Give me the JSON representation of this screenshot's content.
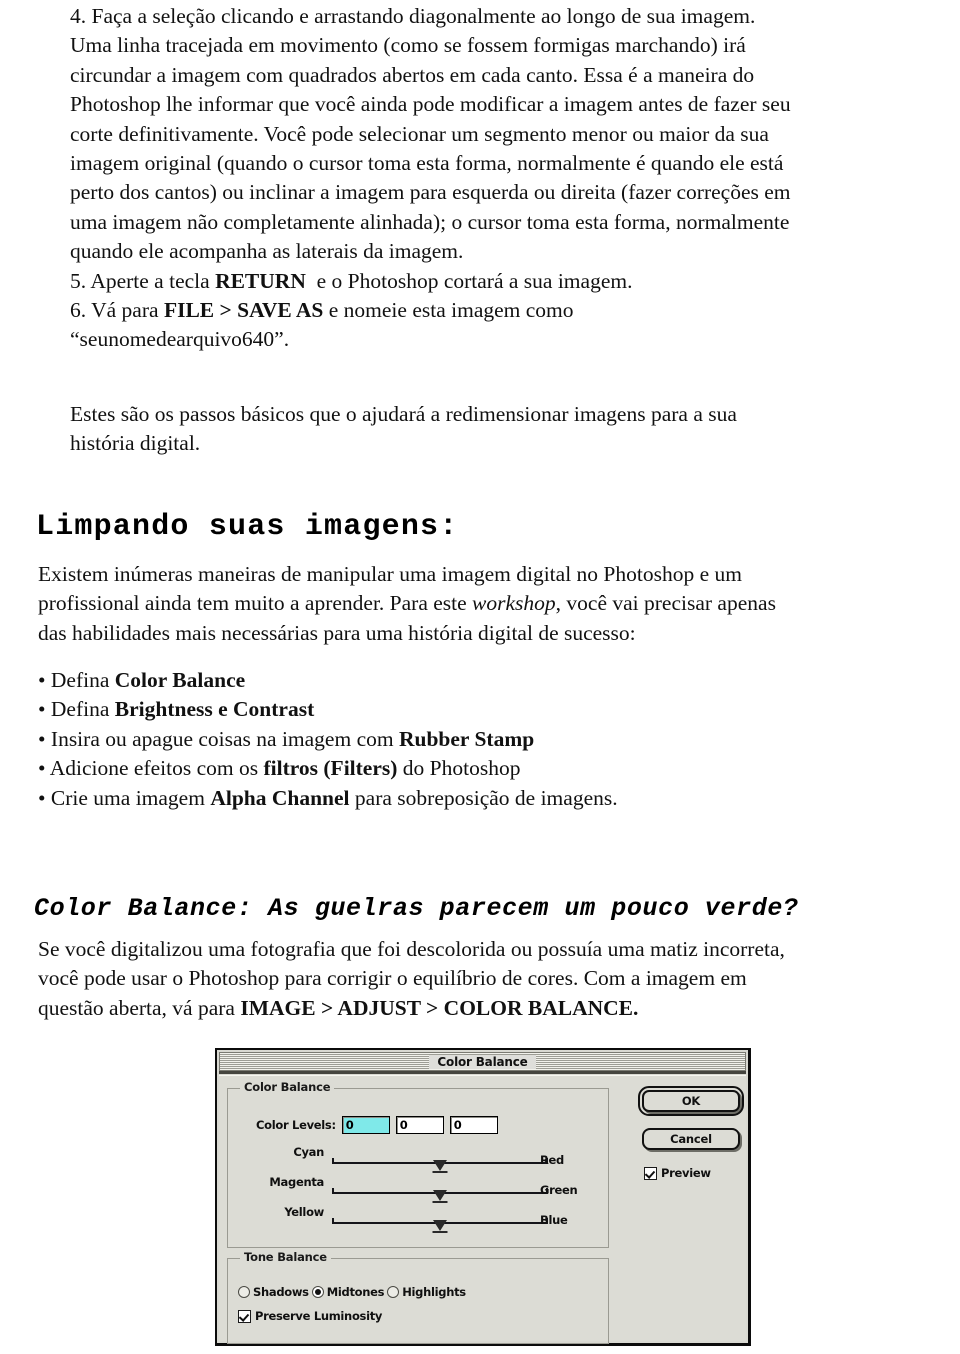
{
  "document": {
    "steps_block": {
      "lines": [
        "4. Faça a seleção clicando e arrastando diagonalmente ao longo de sua imagem.",
        "Uma linha tracejada em movimento (como se fossem formigas marchando) irá",
        "circundar a imagem com quadrados abertos em cada canto. Essa é a maneira do",
        "Photoshop lhe informar que você ainda pode modificar a imagem antes de fazer seu",
        "corte definitivamente. Você pode selecionar um segmento menor ou maior da sua",
        "imagem original (quando o cursor toma esta forma, normalmente é quando ele está",
        "perto dos cantos) ou inclinar a imagem para esquerda ou direita (fazer correções em",
        "uma imagem não completamente alinhada); o cursor toma esta forma, normalmente",
        "quando ele acompanha as laterais da imagem."
      ],
      "step5_prefix": "5. Aperte a tecla ",
      "step5_bold": "RETURN",
      "step5_suffix": "  e o Photoshop cortará a sua imagem.",
      "step6_prefix": "6. Vá para ",
      "step6_bold": "FILE > SAVE AS",
      "step6_suffix": " e nomeie esta imagem como",
      "step6_line2": "“seunomedearquivo640”."
    },
    "estes_block": {
      "line1": "Estes são os passos básicos que o ajudará a redimensionar imagens para a sua",
      "line2": "história digital."
    },
    "heading_limpando": "Limpando suas imagens:",
    "existem_block": {
      "line1": "Existem inúmeras maneiras de manipular uma imagem digital no Photoshop e um",
      "line2_a": "profissional ainda tem muito a aprender. Para este ",
      "line2_italic": "workshop",
      "line2_b": ", você vai precisar apenas",
      "line3": "das habilidades mais necessárias para uma história digital de sucesso:"
    },
    "bullets": [
      {
        "prefix": "Defina ",
        "bold": "Color Balance",
        "suffix": ""
      },
      {
        "prefix": "Defina ",
        "bold": "Brightness e Contrast",
        "suffix": ""
      },
      {
        "prefix": "Insira ou apague coisas na imagem com ",
        "bold": "Rubber Stamp",
        "suffix": ""
      },
      {
        "prefix": "Adicione efeitos com os ",
        "bold": "filtros (Filters)",
        "suffix": " do Photoshop"
      },
      {
        "prefix": "Crie uma imagem ",
        "bold": "Alpha Channel",
        "suffix": " para sobreposição de imagens."
      }
    ],
    "heading_color_balance": "Color Balance: As guelras parecem um pouco verde?",
    "se_voce_block": {
      "line1": "Se você digitalizou uma fotografia que foi descolorida ou possuía uma matiz incorreta,",
      "line2": "você pode usar o Photoshop para corrigir o equilíbrio de cores. Com a imagem em",
      "line3_prefix": "questão aberta, vá para ",
      "line3_bold": "IMAGE > ADJUST > COLOR BALANCE."
    }
  },
  "dialog": {
    "title": "Color Balance",
    "group_color_balance_label": "Color Balance",
    "color_levels_label": "Color Levels:",
    "color_levels": [
      {
        "value": "0",
        "selected": true
      },
      {
        "value": "0",
        "selected": false
      },
      {
        "value": "0",
        "selected": false
      }
    ],
    "sliders": [
      {
        "left": "Cyan",
        "right": "Red",
        "position": 50
      },
      {
        "left": "Magenta",
        "right": "Green",
        "position": 50
      },
      {
        "left": "Yellow",
        "right": "Blue",
        "position": 50
      }
    ],
    "group_tone_balance_label": "Tone Balance",
    "tone_options": [
      {
        "label": "Shadows",
        "checked": false
      },
      {
        "label": "Midtones",
        "checked": true
      },
      {
        "label": "Highlights",
        "checked": false
      }
    ],
    "preserve_luminosity": {
      "label": "Preserve Luminosity",
      "checked": true
    },
    "ok_label": "OK",
    "cancel_label": "Cancel",
    "preview": {
      "label": "Preview",
      "checked": true
    },
    "colors": {
      "face": "#dcdcd5",
      "selected_field": "#7fe9e9",
      "border": "#111111"
    }
  }
}
